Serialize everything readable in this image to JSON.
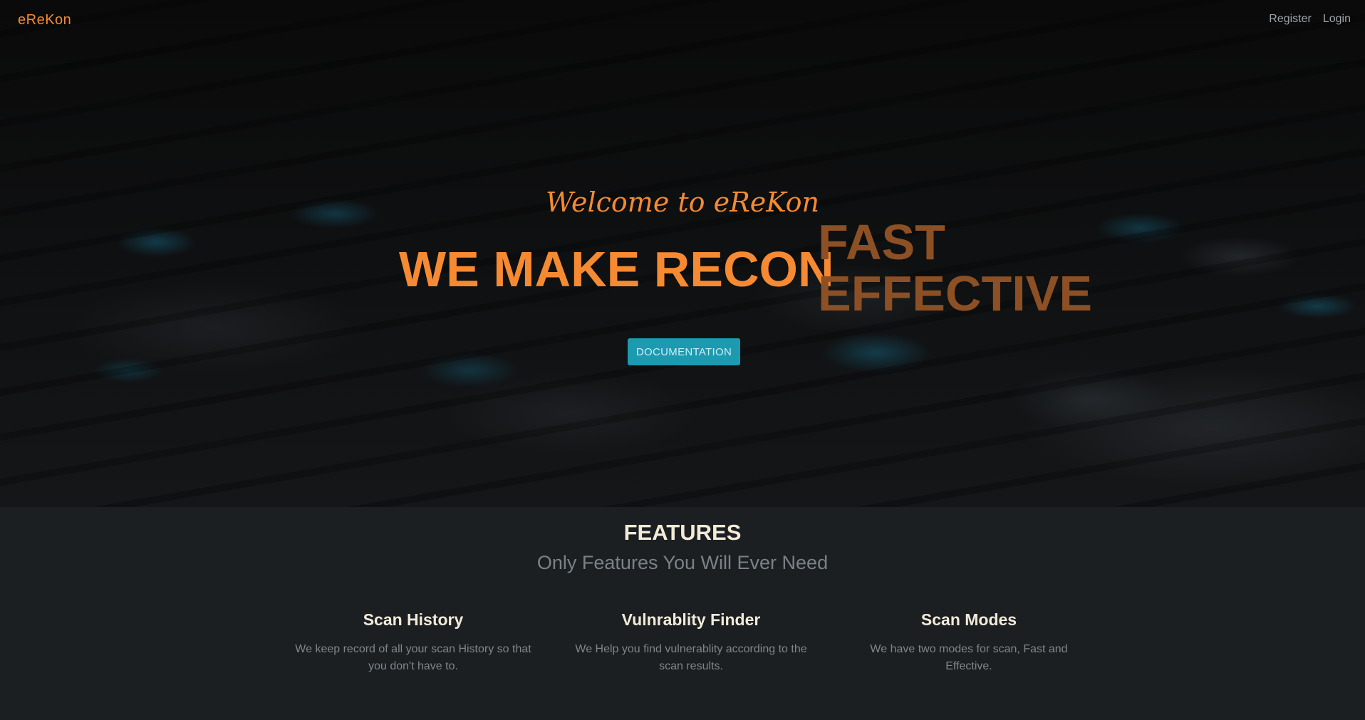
{
  "navbar": {
    "brand": "eReKon",
    "links": [
      {
        "label": "Register"
      },
      {
        "label": "Login"
      }
    ]
  },
  "hero": {
    "welcome": "Welcome to eReKon",
    "headline": "WE MAKE RECON",
    "rotating_words": [
      "FAST",
      "EFFECTIVE"
    ],
    "button_label": "DOCUMENTATION"
  },
  "features": {
    "title": "FEATURES",
    "subtitle": "Only Features You Will Ever Need",
    "items": [
      {
        "title": "Scan History",
        "description": "We keep record of all your scan History so that you don't have to."
      },
      {
        "title": "Vulnrablity Finder",
        "description": "We Help you find vulnerablity according to the scan results."
      },
      {
        "title": "Scan Modes",
        "description": "We have two modes for scan, Fast and Effective."
      }
    ]
  },
  "colors": {
    "accent": "#f58a32",
    "accent_dim": "#8c5024",
    "button": "#1c9bb0",
    "background": "#1b1f22"
  }
}
